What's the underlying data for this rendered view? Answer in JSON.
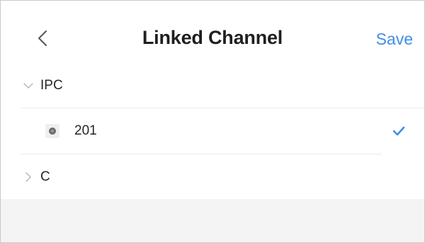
{
  "header": {
    "title": "Linked Channel",
    "save_label": "Save"
  },
  "tree": {
    "groups": [
      {
        "label": "IPC",
        "expanded": true,
        "items": [
          {
            "label": "201",
            "selected": true
          }
        ]
      },
      {
        "label": "C",
        "expanded": false,
        "items": []
      }
    ]
  },
  "colors": {
    "accent": "#3f8de6",
    "text": "#262626",
    "divider": "#ececec",
    "footer_bg": "#f4f4f4"
  },
  "icons": {
    "back": "chevron-left-icon",
    "expanded": "chevron-down-icon",
    "collapsed": "chevron-right-icon",
    "channel": "camera-icon",
    "selected": "checkmark-icon"
  }
}
